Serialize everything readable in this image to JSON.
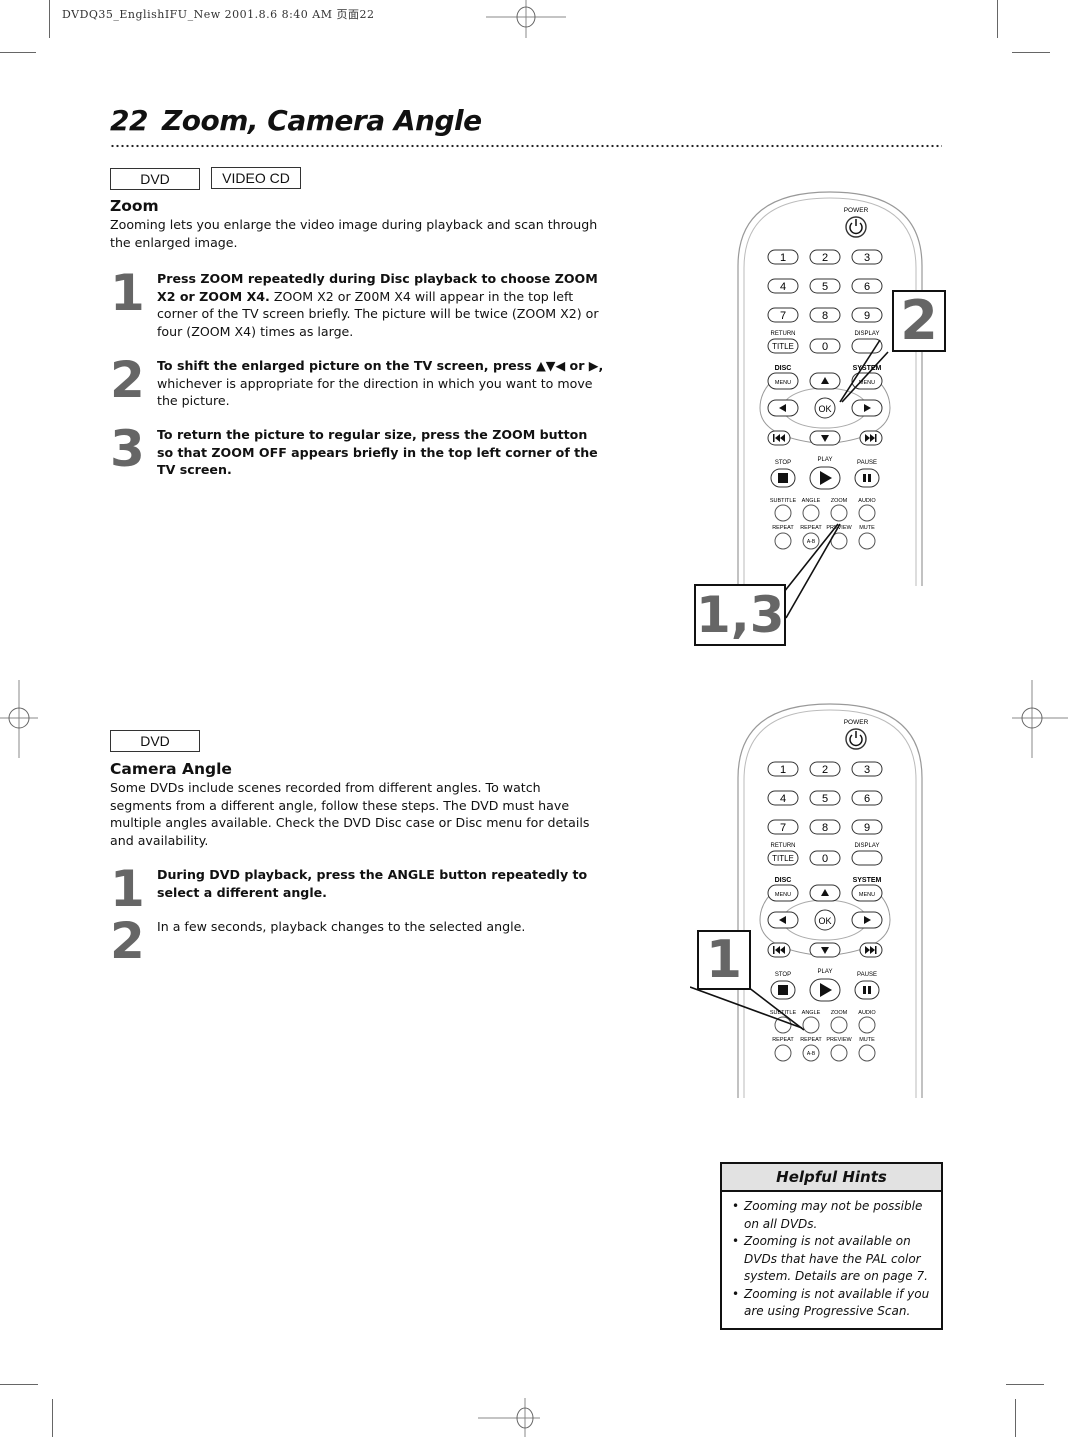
{
  "print_header": "DVDQ35_EnglishIFU_New  2001.8.6 8:40 AM 页面22",
  "page": {
    "number": "22",
    "title": "Zoom, Camera Angle"
  },
  "zoom_section": {
    "badges": [
      "DVD",
      "VIDEO CD"
    ],
    "heading": "Zoom",
    "intro": "Zooming lets you enlarge the video image during playback and scan through the enlarged image.",
    "steps": [
      {
        "num": "1",
        "bold": "Press ZOOM repeatedly during Disc playback to choose ZOOM X2 or ZOOM X4.",
        "text": " ZOOM X2 or Z00M X4 will appear in the top left corner of the TV screen briefly. The picture will be twice (ZOOM X2) or four (ZOOM X4) times as large."
      },
      {
        "num": "2",
        "bold": "To shift the enlarged picture on the TV screen, press ▲▼◀ or ▶,",
        "text": " whichever is appropriate for the direction in which you want to move the picture."
      },
      {
        "num": "3",
        "bold": "To return the picture to regular size, press the ZOOM button so that ZOOM OFF appears briefly in the top left corner of the TV screen.",
        "text": ""
      }
    ],
    "callouts": [
      "2",
      "1,3"
    ]
  },
  "angle_section": {
    "badges": [
      "DVD"
    ],
    "heading": "Camera Angle",
    "intro": "Some DVDs include scenes recorded from different angles. To watch segments from a different angle, follow these steps. The DVD must have multiple angles available. Check the DVD Disc case or Disc menu for details and availability.",
    "steps": [
      {
        "num": "1",
        "bold": "During DVD playback, press the ANGLE button repeatedly to select a different angle.",
        "text": ""
      },
      {
        "num": "2",
        "bold": "",
        "text": "In a few seconds, playback changes to the selected angle."
      }
    ],
    "callouts": [
      "1"
    ]
  },
  "remote": {
    "power": "POWER",
    "digits": [
      "1",
      "2",
      "3",
      "4",
      "5",
      "6",
      "7",
      "8",
      "9",
      "0"
    ],
    "return": "RETURN",
    "title": "TITLE",
    "display": "DISPLAY",
    "disc": "DISC",
    "system": "SYSTEM",
    "menu": "MENU",
    "ok": "OK",
    "stop": "STOP",
    "play": "PLAY",
    "pause": "PAUSE",
    "row1": [
      "SUBTITLE",
      "ANGLE",
      "ZOOM",
      "AUDIO"
    ],
    "row2": [
      "REPEAT",
      "REPEAT",
      "PREVIEW",
      "MUTE"
    ],
    "ab": "A-B"
  },
  "hints": {
    "title": "Helpful Hints",
    "items": [
      "Zooming may not be possible on all DVDs.",
      "Zooming is not available on DVDs that have the PAL color system. Details are on page 7.",
      "Zooming is not available if you are using Progressive Scan."
    ]
  }
}
